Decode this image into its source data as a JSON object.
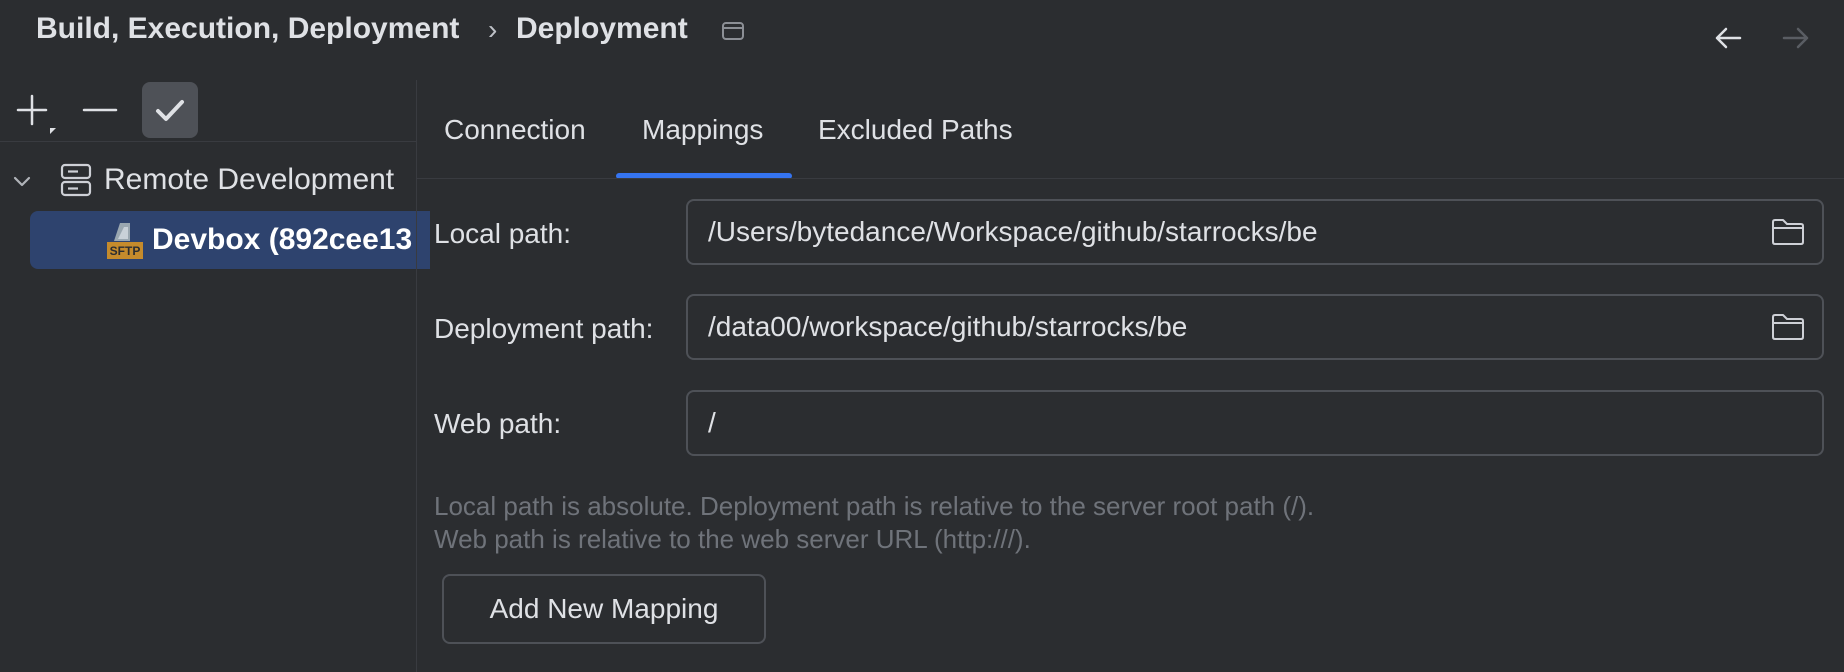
{
  "breadcrumb": {
    "parent": "Build, Execution, Deployment",
    "separator": "›",
    "current": "Deployment"
  },
  "toolbar": {
    "add_icon": "plus-icon",
    "remove_icon": "minus-icon",
    "default_icon": "check-icon"
  },
  "tree": {
    "group_label": "Remote Development",
    "group_icon": "server-icon",
    "selected_item": {
      "label": "Devbox (892cee13",
      "icon": "sftp-icon",
      "icon_text": "SFTP"
    }
  },
  "tabs": [
    {
      "label": "Connection",
      "active": false
    },
    {
      "label": "Mappings",
      "active": true
    },
    {
      "label": "Excluded Paths",
      "active": false
    }
  ],
  "mapping": {
    "local_label": "Local path:",
    "local_value": "/Users/bytedance/Workspace/github/starrocks/be",
    "deploy_label": "Deployment path:",
    "deploy_value": "/data00/workspace/github/starrocks/be",
    "web_label": "Web path:",
    "web_value": "/"
  },
  "hints": {
    "line1": "Local path is absolute. Deployment path is relative to the server root path (/).",
    "line2": "Web path is relative to the web server URL (http:///)."
  },
  "add_mapping_label": "Add New Mapping",
  "colors": {
    "background": "#2b2d30",
    "selection": "#2e436e",
    "accent": "#3574f0",
    "hint_text": "#6f737a"
  }
}
